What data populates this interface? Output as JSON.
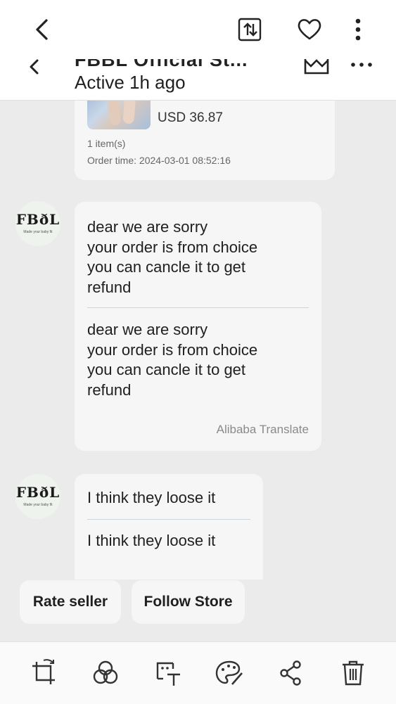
{
  "top_bar": {
    "back_icon": "chevron-left-icon",
    "share_icon": "share-arrows-icon",
    "favorite_icon": "heart-icon",
    "more_icon": "vertical-dots-icon"
  },
  "chat_header": {
    "store_name": "FBBL Official St...",
    "status": "Active 1h ago",
    "back_icon": "chevron-left-icon",
    "store_icon": "store-crown-icon",
    "more_icon": "horizontal-dots-icon"
  },
  "order": {
    "price": "USD 36.87",
    "items": "1 item(s)",
    "order_time": "Order time: 2024-03-01 08:52:16"
  },
  "store_avatar": {
    "logo_text": "FBðL",
    "tagline": "Made your baby fit"
  },
  "messages": [
    {
      "original": "dear we are sorry\nyour order is from choice\nyou can cancle it to get\nrefund",
      "translated": "dear we are sorry\nyour order is from choice\nyou can cancle it to get\nrefund",
      "translate_label": "Alibaba Translate"
    },
    {
      "original": "I think they loose it",
      "translated": "I think they loose it"
    }
  ],
  "actions": {
    "rate_seller": "Rate seller",
    "follow_store": "Follow Store"
  },
  "bottom_bar": {
    "icons": [
      "crop-rotate-icon",
      "filters-icon",
      "text-extract-icon",
      "palette-brush-icon",
      "share-icon",
      "trash-icon"
    ]
  },
  "colors": {
    "background": "#ebebeb",
    "bubble": "#f6f6f6",
    "divider": "#c9d6e2"
  }
}
